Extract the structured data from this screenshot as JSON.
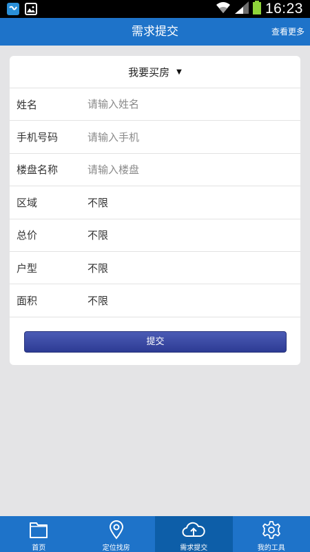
{
  "status_bar": {
    "time": "16:23"
  },
  "header": {
    "title": "需求提交",
    "more_link": "查看更多"
  },
  "form": {
    "type_select": "我要买房",
    "fields": [
      {
        "label": "姓名",
        "placeholder": "请输入姓名"
      },
      {
        "label": "手机号码",
        "placeholder": "请输入手机"
      },
      {
        "label": "楼盘名称",
        "placeholder": "请输入楼盘"
      },
      {
        "label": "区域",
        "value": "不限"
      },
      {
        "label": "总价",
        "value": "不限"
      },
      {
        "label": "户型",
        "value": "不限"
      },
      {
        "label": "面积",
        "value": "不限"
      }
    ],
    "submit_label": "提交"
  },
  "tabs": [
    {
      "label": "首页",
      "icon": "folder-icon"
    },
    {
      "label": "定位找房",
      "icon": "location-pin-icon"
    },
    {
      "label": "需求提交",
      "icon": "cloud-upload-icon",
      "active": true
    },
    {
      "label": "我的工具",
      "icon": "gear-icon"
    }
  ],
  "colors": {
    "header": "#1e73c9",
    "active_tab": "#0d5ea8",
    "button": "#3a48a4",
    "background": "#e4e4e6"
  }
}
